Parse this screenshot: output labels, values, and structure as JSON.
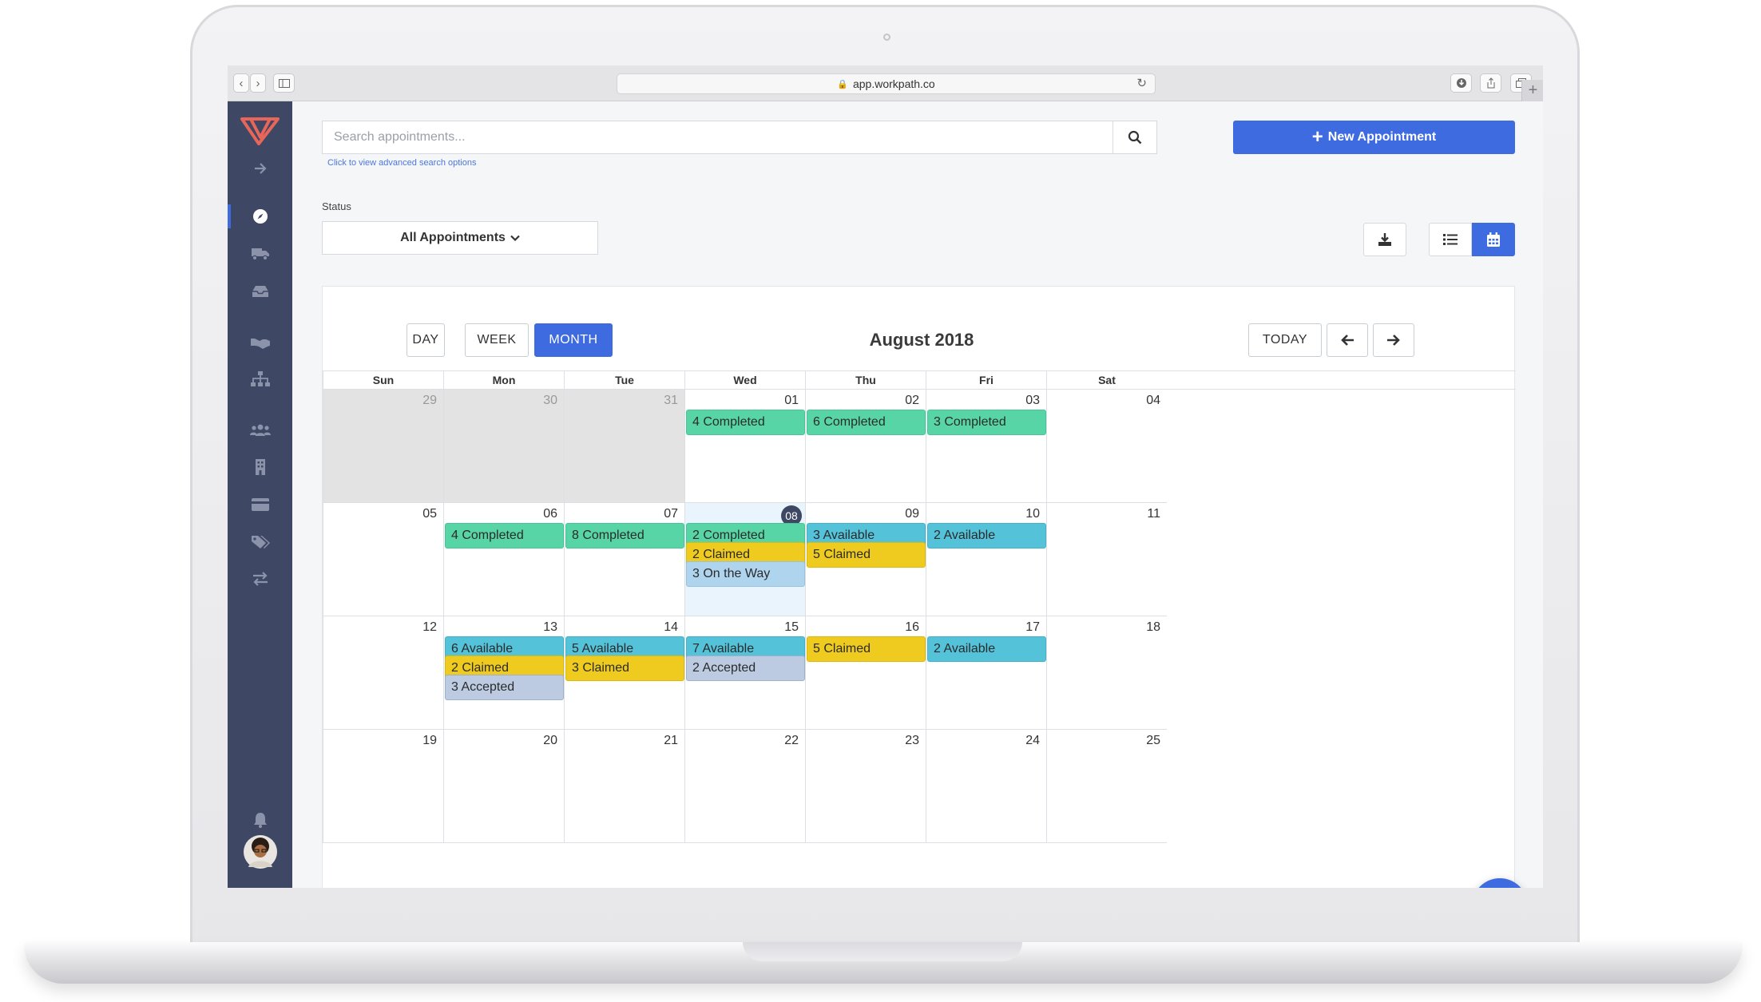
{
  "browser": {
    "url": "app.workpath.co",
    "icons": [
      "back-icon",
      "forward-icon",
      "sidebar-toggle-icon",
      "lock-icon",
      "reload-icon",
      "download-icon",
      "share-icon",
      "tabs-icon",
      "plus-icon"
    ]
  },
  "sidebar": {
    "items": [
      "logo",
      "expand-arrow",
      "dashboard-compass",
      "truck",
      "inbox",
      "handshake",
      "org-chart",
      "users",
      "building",
      "credit-card",
      "tags",
      "exchange",
      "notification-bell",
      "user-avatar"
    ],
    "active": "dashboard-compass"
  },
  "search": {
    "placeholder": "Search appointments...",
    "value": "",
    "advanced_link": "Click to view advanced search options"
  },
  "new_appointment": {
    "label": "New Appointment"
  },
  "status": {
    "label": "Status",
    "selected": "All Appointments"
  },
  "view_buttons": {
    "day": "DAY",
    "week": "WEEK",
    "month": "MONTH",
    "active": "month"
  },
  "calendar": {
    "title": "August 2018",
    "today_label": "TODAY",
    "weekdays": [
      "Sun",
      "Mon",
      "Tue",
      "Wed",
      "Thu",
      "Fri",
      "Sat"
    ],
    "weeks": [
      {
        "days": [
          {
            "num": "29",
            "other": true,
            "events": []
          },
          {
            "num": "30",
            "other": true,
            "events": []
          },
          {
            "num": "31",
            "other": true,
            "events": []
          },
          {
            "num": "01",
            "events": [
              {
                "label": "4 Completed",
                "type": "completed"
              }
            ]
          },
          {
            "num": "02",
            "events": [
              {
                "label": "6 Completed",
                "type": "completed"
              }
            ]
          },
          {
            "num": "03",
            "events": [
              {
                "label": "3 Completed",
                "type": "completed"
              }
            ]
          },
          {
            "num": "04",
            "events": []
          }
        ]
      },
      {
        "days": [
          {
            "num": "05",
            "events": []
          },
          {
            "num": "06",
            "events": [
              {
                "label": "4 Completed",
                "type": "completed"
              }
            ]
          },
          {
            "num": "07",
            "events": [
              {
                "label": "8 Completed",
                "type": "completed"
              }
            ]
          },
          {
            "num": "08",
            "today": true,
            "events": [
              {
                "label": "2 Completed",
                "type": "completed"
              },
              {
                "label": "2 Claimed",
                "type": "claimed"
              },
              {
                "label": "3 On the Way",
                "type": "ontheway"
              }
            ]
          },
          {
            "num": "09",
            "events": [
              {
                "label": "3 Available",
                "type": "available"
              },
              {
                "label": "5 Claimed",
                "type": "claimed"
              }
            ]
          },
          {
            "num": "10",
            "events": [
              {
                "label": "2 Available",
                "type": "available"
              }
            ]
          },
          {
            "num": "11",
            "events": []
          }
        ]
      },
      {
        "days": [
          {
            "num": "12",
            "events": []
          },
          {
            "num": "13",
            "events": [
              {
                "label": "6 Available",
                "type": "available"
              },
              {
                "label": "2 Claimed",
                "type": "claimed"
              },
              {
                "label": "3 Accepted",
                "type": "accepted"
              }
            ]
          },
          {
            "num": "14",
            "events": [
              {
                "label": "5 Available",
                "type": "available"
              },
              {
                "label": "3 Claimed",
                "type": "claimed"
              }
            ]
          },
          {
            "num": "15",
            "events": [
              {
                "label": "7 Available",
                "type": "available"
              },
              {
                "label": "2 Accepted",
                "type": "accepted"
              }
            ]
          },
          {
            "num": "16",
            "events": [
              {
                "label": "5 Claimed",
                "type": "claimed"
              }
            ]
          },
          {
            "num": "17",
            "events": [
              {
                "label": "2 Available",
                "type": "available"
              }
            ]
          },
          {
            "num": "18",
            "events": []
          }
        ]
      },
      {
        "days": [
          {
            "num": "19",
            "events": []
          },
          {
            "num": "20",
            "events": []
          },
          {
            "num": "21",
            "events": []
          },
          {
            "num": "22",
            "events": []
          },
          {
            "num": "23",
            "events": []
          },
          {
            "num": "24",
            "events": []
          },
          {
            "num": "25",
            "events": []
          }
        ]
      }
    ]
  },
  "colors": {
    "accent": "#3f6be1",
    "sidebar": "#3e4763",
    "completed": "#58d5a6",
    "available": "#54c2d9",
    "claimed": "#eecb1e",
    "on_the_way": "#afd4ee",
    "accepted": "#bccbe1"
  }
}
